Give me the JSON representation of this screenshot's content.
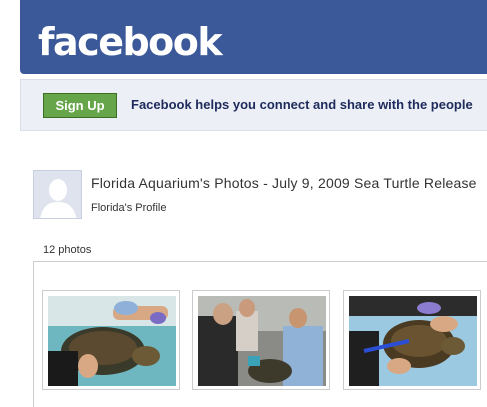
{
  "header": {
    "logo": "facebook"
  },
  "signup_bar": {
    "button_label": "Sign Up",
    "tagline": "Facebook helps you connect and share with the people"
  },
  "album": {
    "title": "Florida Aquarium's Photos - July 9, 2009 Sea Turtle Release",
    "profile_link": "Florida's Profile",
    "photo_count": "12 photos",
    "photos": [
      {
        "name": "photo-1",
        "description": "volunteer holding sea turtle"
      },
      {
        "name": "photo-2",
        "description": "team examining sea turtle"
      },
      {
        "name": "photo-3",
        "description": "tagging sea turtle flipper"
      }
    ]
  },
  "colors": {
    "brand_blue": "#3b5998",
    "signup_green": "#67a54b",
    "bar_bg": "#eceff5"
  }
}
